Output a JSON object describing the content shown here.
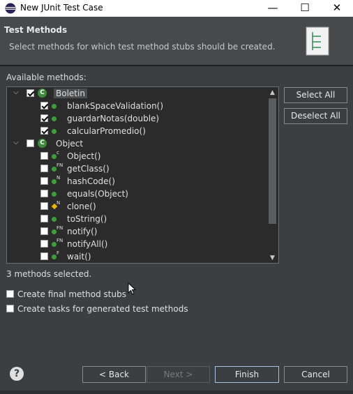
{
  "window": {
    "title": "New JUnit Test Case",
    "minimize": "—",
    "maximize": "☐",
    "close": "✕"
  },
  "header": {
    "title": "Test Methods",
    "description": "Select methods for which test method stubs should be created."
  },
  "available_label": "Available methods:",
  "tree": [
    {
      "text": "Boletin",
      "level": 0,
      "expanded": true,
      "checked": true,
      "icon": "class-icon",
      "overlay": "",
      "selected": true
    },
    {
      "text": "blankSpaceValidation()",
      "level": 1,
      "checked": true,
      "icon": "public-method-icon",
      "overlay": ""
    },
    {
      "text": "guardarNotas(double)",
      "level": 1,
      "checked": true,
      "icon": "public-method-icon",
      "overlay": ""
    },
    {
      "text": "calcularPromedio()",
      "level": 1,
      "checked": true,
      "icon": "public-method-icon",
      "overlay": ""
    },
    {
      "text": "Object",
      "level": 0,
      "expanded": true,
      "checked": false,
      "icon": "class-icon",
      "overlay": ""
    },
    {
      "text": "Object()",
      "level": 1,
      "checked": false,
      "icon": "public-method-icon",
      "overlay": "c"
    },
    {
      "text": "getClass()",
      "level": 1,
      "checked": false,
      "icon": "public-method-icon",
      "overlay": "FN"
    },
    {
      "text": "hashCode()",
      "level": 1,
      "checked": false,
      "icon": "public-method-icon",
      "overlay": "N"
    },
    {
      "text": "equals(Object)",
      "level": 1,
      "checked": false,
      "icon": "public-method-icon",
      "overlay": ""
    },
    {
      "text": "clone()",
      "level": 1,
      "checked": false,
      "icon": "protected-method-icon",
      "overlay": "N"
    },
    {
      "text": "toString()",
      "level": 1,
      "checked": false,
      "icon": "public-method-icon",
      "overlay": ""
    },
    {
      "text": "notify()",
      "level": 1,
      "checked": false,
      "icon": "public-method-icon",
      "overlay": "FN"
    },
    {
      "text": "notifyAll()",
      "level": 1,
      "checked": false,
      "icon": "public-method-icon",
      "overlay": "FN"
    },
    {
      "text": "wait()",
      "level": 1,
      "checked": false,
      "icon": "public-method-icon",
      "overlay": "F"
    }
  ],
  "buttons": {
    "select_all": "Select All",
    "deselect_all": "Deselect All"
  },
  "status": "3 methods selected.",
  "options": [
    {
      "label": "Create final method stubs",
      "checked": false
    },
    {
      "label": "Create tasks for generated test methods",
      "checked": false
    }
  ],
  "footer": {
    "back": "< Back",
    "next": "Next >",
    "finish": "Finish",
    "cancel": "Cancel"
  },
  "colors": {
    "background": "#3c3f41",
    "tree_bg": "#2b2b2b",
    "class_icon": "#3b8b3b",
    "method_dot": "#3aa13a",
    "protected_icon": "#e8b800"
  }
}
